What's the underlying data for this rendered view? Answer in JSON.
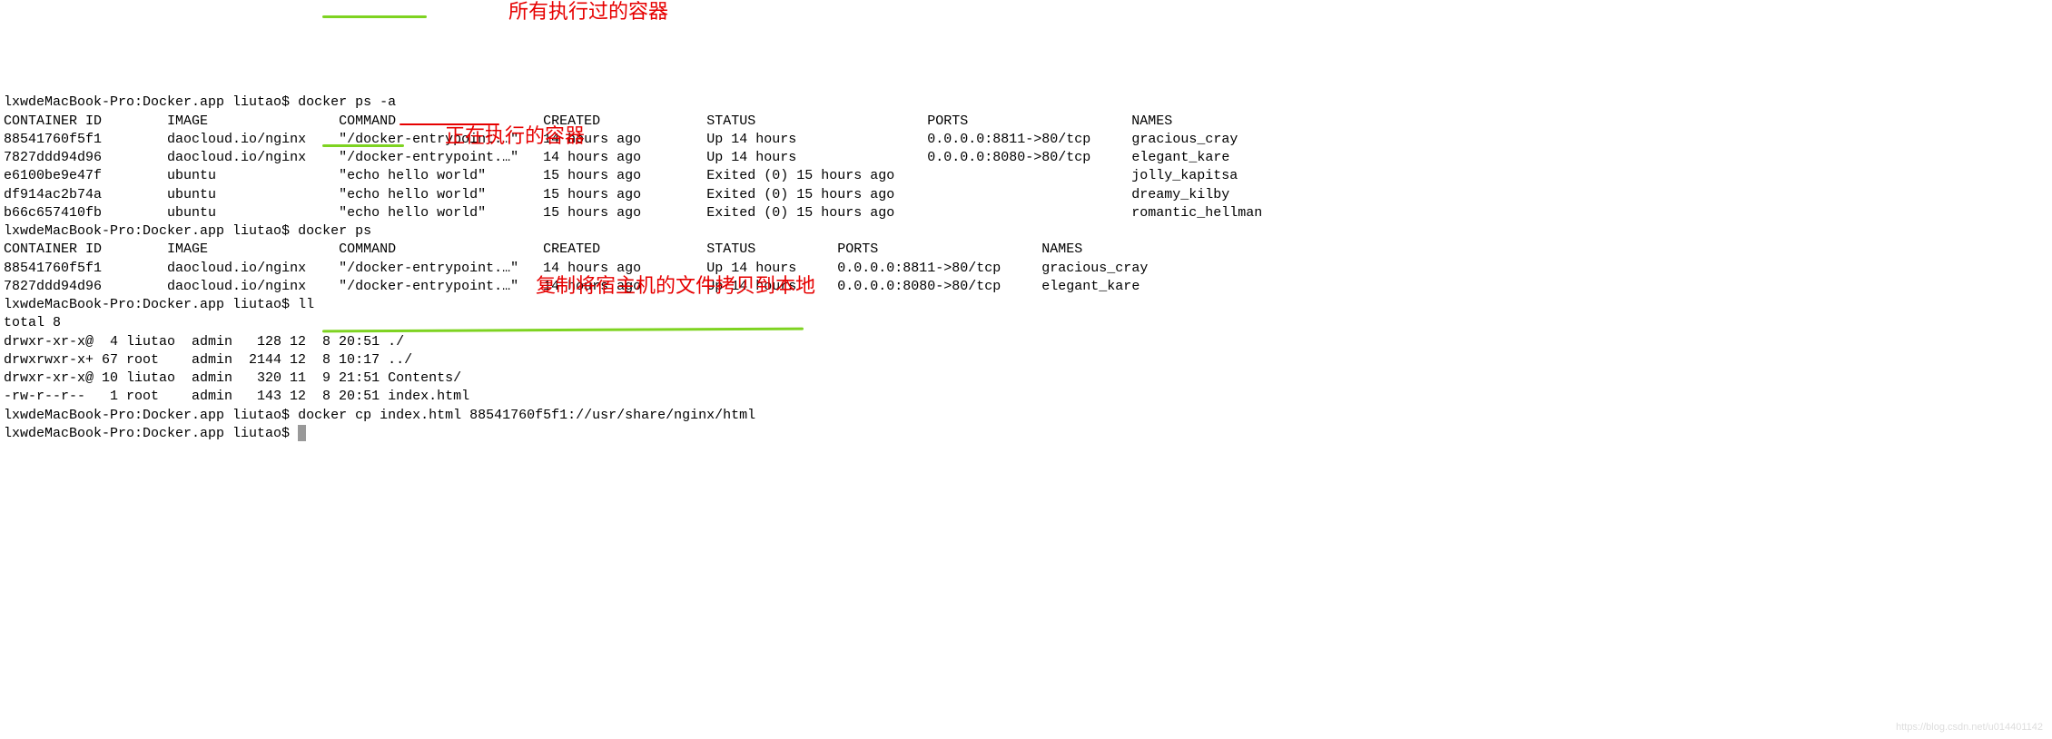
{
  "prompt": "lxwdeMacBook-Pro:Docker.app liutao$ ",
  "commands": {
    "ps_a": "docker ps -a",
    "ps": "docker ps",
    "ll": "ll",
    "cp": "docker cp index.html 88541760f5f1://usr/share/nginx/html"
  },
  "headers": {
    "container_id": "CONTAINER ID",
    "image": "IMAGE",
    "command": "COMMAND",
    "created": "CREATED",
    "status": "STATUS",
    "ports": "PORTS",
    "names": "NAMES"
  },
  "containers_all": [
    {
      "id": "88541760f5f1",
      "image": "daocloud.io/nginx",
      "command": "\"/docker-entrypoint.…\"",
      "created": "14 hours ago",
      "status": "Up 14 hours",
      "ports": "0.0.0.0:8811->80/tcp",
      "names": "gracious_cray"
    },
    {
      "id": "7827ddd94d96",
      "image": "daocloud.io/nginx",
      "command": "\"/docker-entrypoint.…\"",
      "created": "14 hours ago",
      "status": "Up 14 hours",
      "ports": "0.0.0.0:8080->80/tcp",
      "names": "elegant_kare"
    },
    {
      "id": "e6100be9e47f",
      "image": "ubuntu",
      "command": "\"echo hello world\"",
      "created": "15 hours ago",
      "status": "Exited (0) 15 hours ago",
      "ports": "",
      "names": "jolly_kapitsa"
    },
    {
      "id": "df914ac2b74a",
      "image": "ubuntu",
      "command": "\"echo hello world\"",
      "created": "15 hours ago",
      "status": "Exited (0) 15 hours ago",
      "ports": "",
      "names": "dreamy_kilby"
    },
    {
      "id": "b66c657410fb",
      "image": "ubuntu",
      "command": "\"echo hello world\"",
      "created": "15 hours ago",
      "status": "Exited (0) 15 hours ago",
      "ports": "",
      "names": "romantic_hellman"
    }
  ],
  "containers_running": [
    {
      "id": "88541760f5f1",
      "image": "daocloud.io/nginx",
      "command": "\"/docker-entrypoint.…\"",
      "created": "14 hours ago",
      "status": "Up 14 hours",
      "ports": "0.0.0.0:8811->80/tcp",
      "names": "gracious_cray"
    },
    {
      "id": "7827ddd94d96",
      "image": "daocloud.io/nginx",
      "command": "\"/docker-entrypoint.…\"",
      "created": "14 hours ago",
      "status": "Up 14 hours",
      "ports": "0.0.0.0:8080->80/tcp",
      "names": "elegant_kare"
    }
  ],
  "ll_output": {
    "total": "total 8",
    "rows": [
      "drwxr-xr-x@  4 liutao  admin   128 12  8 20:51 ./",
      "drwxrwxr-x+ 67 root    admin  2144 12  8 10:17 ../",
      "drwxr-xr-x@ 10 liutao  admin   320 11  9 21:51 Contents/",
      "-rw-r--r--   1 root    admin   143 12  8 20:51 index.html"
    ]
  },
  "annotations": {
    "all": "所有执行过的容器",
    "running": "正在执行的容器",
    "copy": "复制将宿主机的文件拷贝到本地"
  },
  "watermark": "https://blog.csdn.net/u014401142"
}
